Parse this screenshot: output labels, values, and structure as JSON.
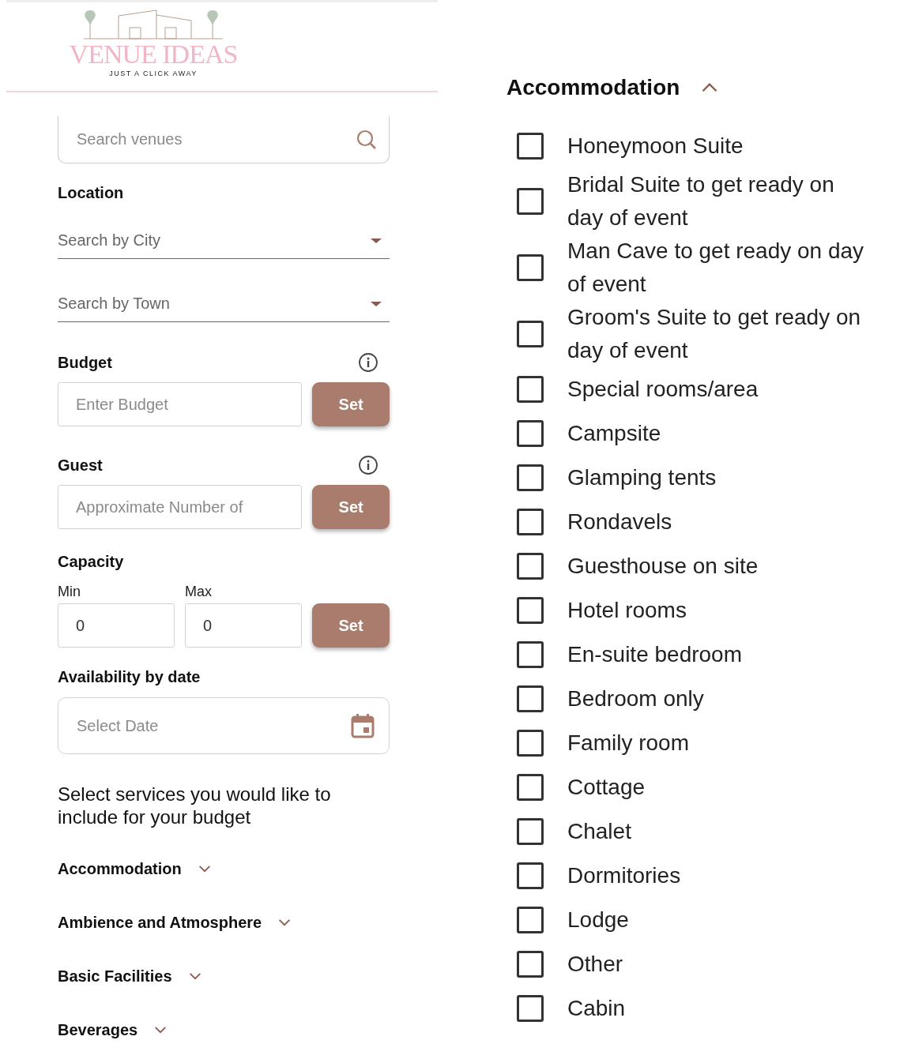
{
  "logo": {
    "title": "VENUE IDEAS",
    "tagline": "JUST A CLICK AWAY"
  },
  "search": {
    "placeholder": "Search venues"
  },
  "location": {
    "label": "Location",
    "dropdowns": [
      {
        "placeholder": "Search by City"
      },
      {
        "placeholder": "Search by Town"
      }
    ]
  },
  "budget": {
    "label": "Budget",
    "placeholder": "Enter Budget",
    "button": "Set"
  },
  "guest": {
    "label": "Guest",
    "placeholder": "Approximate Number of",
    "button": "Set"
  },
  "capacity": {
    "label": "Capacity",
    "min_label": "Min",
    "min_value": "0",
    "max_label": "Max",
    "max_value": "0",
    "button": "Set"
  },
  "availability": {
    "label": "Availability by date",
    "placeholder": "Select Date"
  },
  "services_intro": "Select services you would like to include for your budget",
  "service_groups": [
    {
      "label": "Accommodation",
      "expanded": false
    },
    {
      "label": "Ambience and Atmosphere",
      "expanded": false
    },
    {
      "label": "Basic Facilities",
      "expanded": false
    },
    {
      "label": "Beverages",
      "expanded": false
    }
  ],
  "accommodation_panel": {
    "title": "Accommodation",
    "expanded": true,
    "options": [
      {
        "label": "Honeymoon Suite",
        "checked": false
      },
      {
        "label": "Bridal Suite to get ready on day of event",
        "checked": false
      },
      {
        "label": "Man Cave to get ready on day of event",
        "checked": false
      },
      {
        "label": "Groom's Suite to get ready on day of event",
        "checked": false
      },
      {
        "label": "Special rooms/area",
        "checked": false
      },
      {
        "label": "Campsite",
        "checked": false
      },
      {
        "label": "Glamping tents",
        "checked": false
      },
      {
        "label": "Rondavels",
        "checked": false
      },
      {
        "label": "Guesthouse on site",
        "checked": false
      },
      {
        "label": "Hotel rooms",
        "checked": false
      },
      {
        "label": "En-suite bedroom",
        "checked": false
      },
      {
        "label": "Bedroom only",
        "checked": false
      },
      {
        "label": "Family room",
        "checked": false
      },
      {
        "label": "Cottage",
        "checked": false
      },
      {
        "label": "Chalet",
        "checked": false
      },
      {
        "label": "Dormitories",
        "checked": false
      },
      {
        "label": "Lodge",
        "checked": false
      },
      {
        "label": "Other",
        "checked": false
      },
      {
        "label": "Cabin",
        "checked": false
      }
    ]
  }
}
